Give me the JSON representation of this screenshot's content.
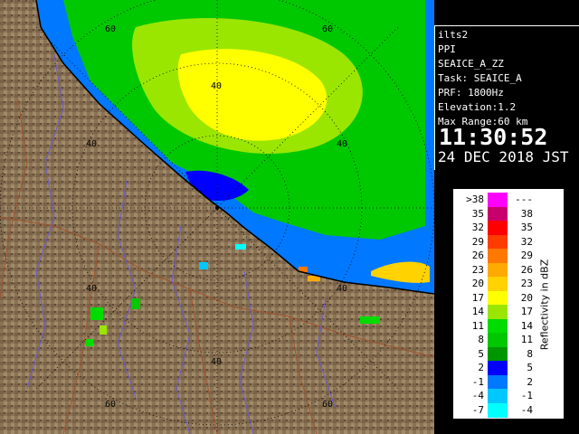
{
  "info_panel": {
    "station": "ilts2",
    "scan_type": "PPI",
    "product": "SEAICE_A_ZZ",
    "task": "Task: SEAICE_A",
    "prf": "PRF: 1800Hz",
    "elevation": "Elevation:1.2",
    "max_range": "Max Range:60 km",
    "time": "11:30:52",
    "date": "24 DEC 2018 JST"
  },
  "legend": {
    "title": "Reflectivity in dBZ",
    "rows": [
      {
        "low": ">38",
        "high": "---",
        "color": "#ff00ff"
      },
      {
        "low": "35",
        "high": "38",
        "color": "#c8006e"
      },
      {
        "low": "32",
        "high": "35",
        "color": "#ff0000"
      },
      {
        "low": "29",
        "high": "32",
        "color": "#ff3c00"
      },
      {
        "low": "26",
        "high": "29",
        "color": "#ff7800"
      },
      {
        "low": "23",
        "high": "26",
        "color": "#ffaa00"
      },
      {
        "low": "20",
        "high": "23",
        "color": "#ffd200"
      },
      {
        "low": "17",
        "high": "20",
        "color": "#ffff00"
      },
      {
        "low": "14",
        "high": "17",
        "color": "#9ae600"
      },
      {
        "low": "11",
        "high": "14",
        "color": "#00dc00"
      },
      {
        "low": "8",
        "high": "11",
        "color": "#00c800"
      },
      {
        "low": "5",
        "high": "8",
        "color": "#009600"
      },
      {
        "low": "2",
        "high": "5",
        "color": "#0000ff"
      },
      {
        "low": "-1",
        "high": "2",
        "color": "#0078ff"
      },
      {
        "low": "-4",
        "high": "-1",
        "color": "#00c8ff"
      },
      {
        "low": "-7",
        "high": "-4",
        "color": "#00ffff"
      }
    ]
  },
  "map": {
    "ring_labels": [
      "40",
      "60"
    ],
    "colors": {
      "land": "#8a7355",
      "sea": "#000000",
      "coast": "#000000",
      "rivers": "#6a5acd",
      "borders": "#a0522d",
      "rings": "#000000"
    }
  }
}
